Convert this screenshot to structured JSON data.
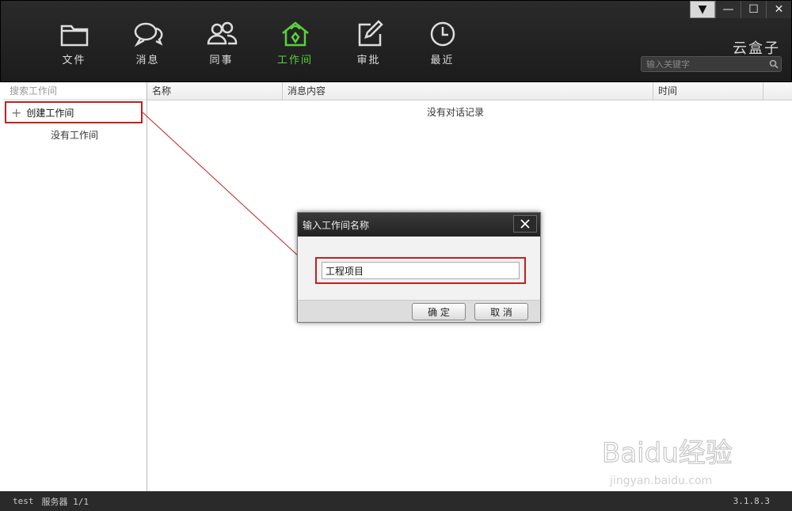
{
  "window": {
    "controls": [
      "▼",
      "—",
      "☐",
      "✕"
    ]
  },
  "nav": {
    "items": [
      {
        "label": "文件",
        "icon": "folder-icon",
        "active": false
      },
      {
        "label": "消息",
        "icon": "chat-icon",
        "active": false
      },
      {
        "label": "同事",
        "icon": "colleagues-icon",
        "active": false
      },
      {
        "label": "工作间",
        "icon": "workspace-house-icon",
        "active": true
      },
      {
        "label": "审批",
        "icon": "edit-approval-icon",
        "active": false
      },
      {
        "label": "最近",
        "icon": "clock-icon",
        "active": false
      }
    ],
    "active_color": "#5bd03c"
  },
  "brand": "云盒子",
  "search": {
    "placeholder": "输入关键字",
    "icon": "search-icon"
  },
  "sidebar": {
    "search_label": "搜索工作间",
    "create_label": "创建工作间",
    "empty_label": "没有工作间"
  },
  "table": {
    "columns": [
      "名称",
      "消息内容",
      "时间"
    ],
    "empty_text": "没有对话记录"
  },
  "dialog": {
    "title": "输入工作间名称",
    "input_value": "工程项目",
    "ok_label": "确 定",
    "cancel_label": "取 消"
  },
  "status": {
    "user": "test",
    "server": "服务器 1/1",
    "version": "3.1.8.3"
  },
  "highlight_color": "#c32020",
  "watermark": {
    "brand": "Baidu经验",
    "url": "jingyan.baidu.com"
  }
}
